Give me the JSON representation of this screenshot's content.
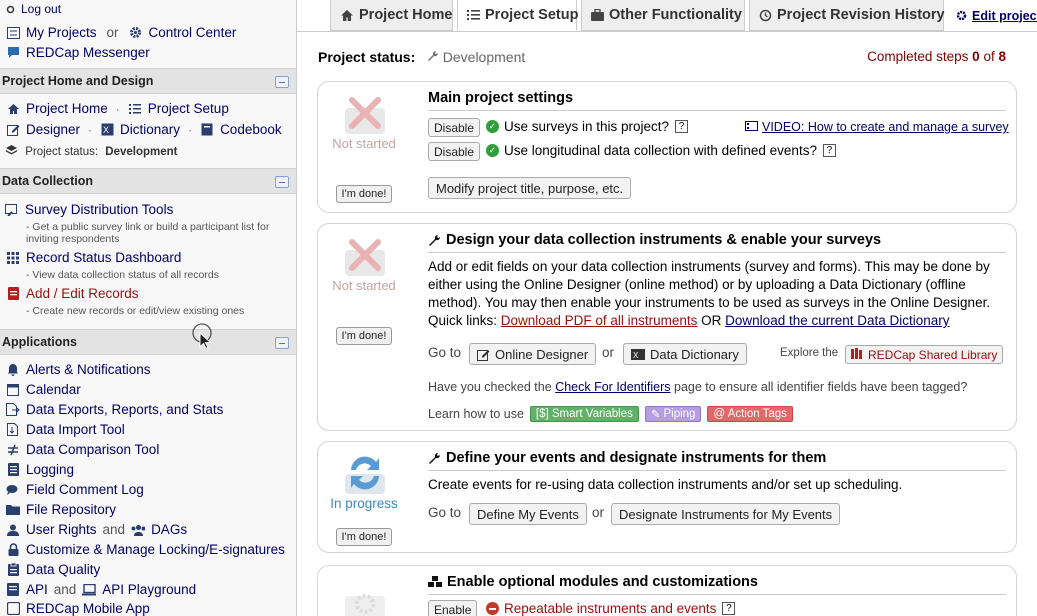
{
  "sidebar": {
    "logout": "Log out",
    "my_projects": "My Projects",
    "or": "or",
    "control_center": "Control Center",
    "messenger": "REDCap Messenger",
    "section_home": "Project Home and Design",
    "project_home": "Project Home",
    "project_setup": "Project Setup",
    "designer": "Designer",
    "dictionary": "Dictionary",
    "codebook": "Codebook",
    "project_status_label": "Project status:",
    "project_status_value": "Development",
    "section_data": "Data Collection",
    "survey_dist": "Survey Distribution Tools",
    "survey_dist_desc": "- Get a public survey link or build a participant list for inviting respondents",
    "record_status": "Record Status Dashboard",
    "record_status_desc": "- View data collection status of all records",
    "add_edit": "Add / Edit Records",
    "add_edit_desc": "- Create new records or edit/view existing ones",
    "section_apps": "Applications",
    "apps": [
      "Alerts & Notifications",
      "Calendar",
      "Data Exports, Reports, and Stats",
      "Data Import Tool",
      "Data Comparison Tool",
      "Logging",
      "Field Comment Log",
      "File Repository"
    ],
    "user_rights": "User Rights",
    "and": "and",
    "dags": "DAGs",
    "locking": "Customize & Manage Locking/E-signatures",
    "data_quality": "Data Quality",
    "api": "API",
    "api_playground": "API Playground",
    "mobile_app": "REDCap Mobile App"
  },
  "tabs": {
    "home": "Project Home",
    "setup": "Project Setup",
    "other": "Other Functionality",
    "revision": "Project Revision History",
    "edit_settings": "Edit project s"
  },
  "status": {
    "label": "Project status:",
    "value": "Development",
    "completed_prefix": "Completed steps",
    "completed_n": "0",
    "of": "of",
    "total": "8"
  },
  "card1": {
    "state": "Not started",
    "done": "I'm done!",
    "title": "Main project settings",
    "disable": "Disable",
    "surveys": "Use surveys in this project?",
    "video": "VIDEO: How to create and manage a survey",
    "longitudinal": "Use longitudinal data collection with defined events?",
    "modify": "Modify project title, purpose, etc."
  },
  "card2": {
    "state": "Not started",
    "done": "I'm done!",
    "title": "Design your data collection instruments & enable your surveys",
    "para": "Add or edit fields on your data collection instruments (survey and forms). This may be done by either using the Online Designer (online method) or by uploading a Data Dictionary (offline method). You may then enable your instruments to be used as surveys in the Online Designer.",
    "quick_links": "Quick links:",
    "pdf_link": "Download PDF of all instruments",
    "or": "OR",
    "dd_link": "Download the current Data Dictionary",
    "goto": "Go to",
    "online_designer": "Online Designer",
    "data_dictionary": "Data Dictionary",
    "explore": "Explore the",
    "shared_lib": "REDCap Shared Library",
    "identifiers_pre": "Have you checked the",
    "identifiers_link": "Check For Identifiers",
    "identifiers_post": "page to ensure all identifier fields have been tagged?",
    "learn": "Learn how to use",
    "smart_vars": "[$] Smart Variables",
    "piping": "Piping",
    "action_tags": "@ Action Tags"
  },
  "card3": {
    "state": "In progress",
    "done": "I'm done!",
    "title": "Define your events and designate instruments for them",
    "para": "Create events for re-using data collection instruments and/or set up scheduling.",
    "goto": "Go to",
    "define": "Define My Events",
    "or": "or",
    "designate": "Designate Instruments for My Events"
  },
  "card4": {
    "title": "Enable optional modules and customizations",
    "enable": "Enable",
    "repeatable": "Repeatable instruments and events"
  },
  "colors": {
    "nav_text": "#000066",
    "accent_red": "#800000",
    "check_green": "#2c9e3a"
  }
}
